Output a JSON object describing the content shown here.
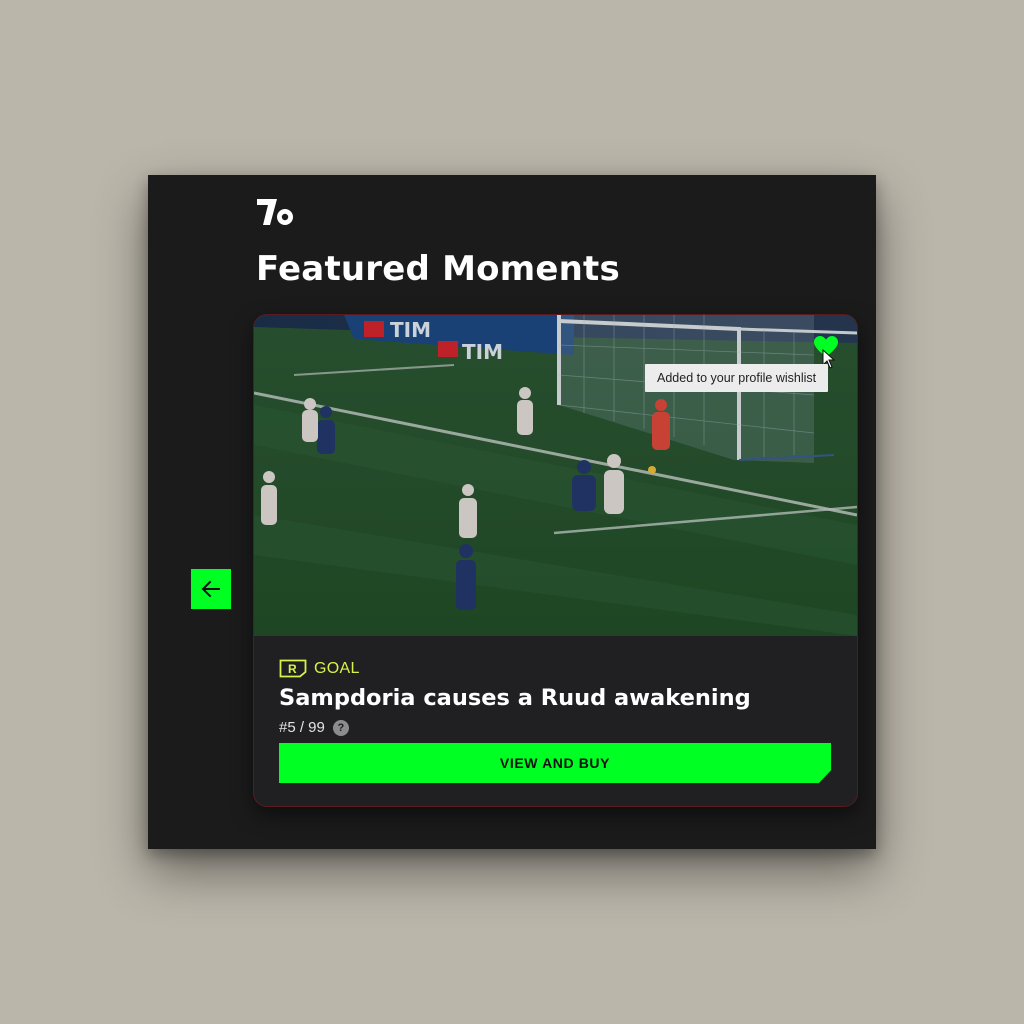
{
  "app": {
    "logo_icon": "brand-slash-dot-logo",
    "section_title": "Featured Moments"
  },
  "carousel": {
    "back_icon": "arrow-left-icon"
  },
  "card": {
    "wishlist_icon": "heart-icon",
    "wishlist_active": true,
    "tooltip_text": "Added to your profile wishlist",
    "rarity_letter": "R",
    "category": "GOAL",
    "title": "Sampdoria causes a Ruud awakening",
    "serial": "#5 / 99",
    "help_glyph": "?",
    "cta_label": "VIEW AND BUY",
    "media_banner_text": "TIM"
  },
  "colors": {
    "accent_green": "#00ff22",
    "category_yellow": "#d7f24a",
    "panel_bg": "#1b1b1c",
    "page_bg": "#bbb6aa"
  }
}
